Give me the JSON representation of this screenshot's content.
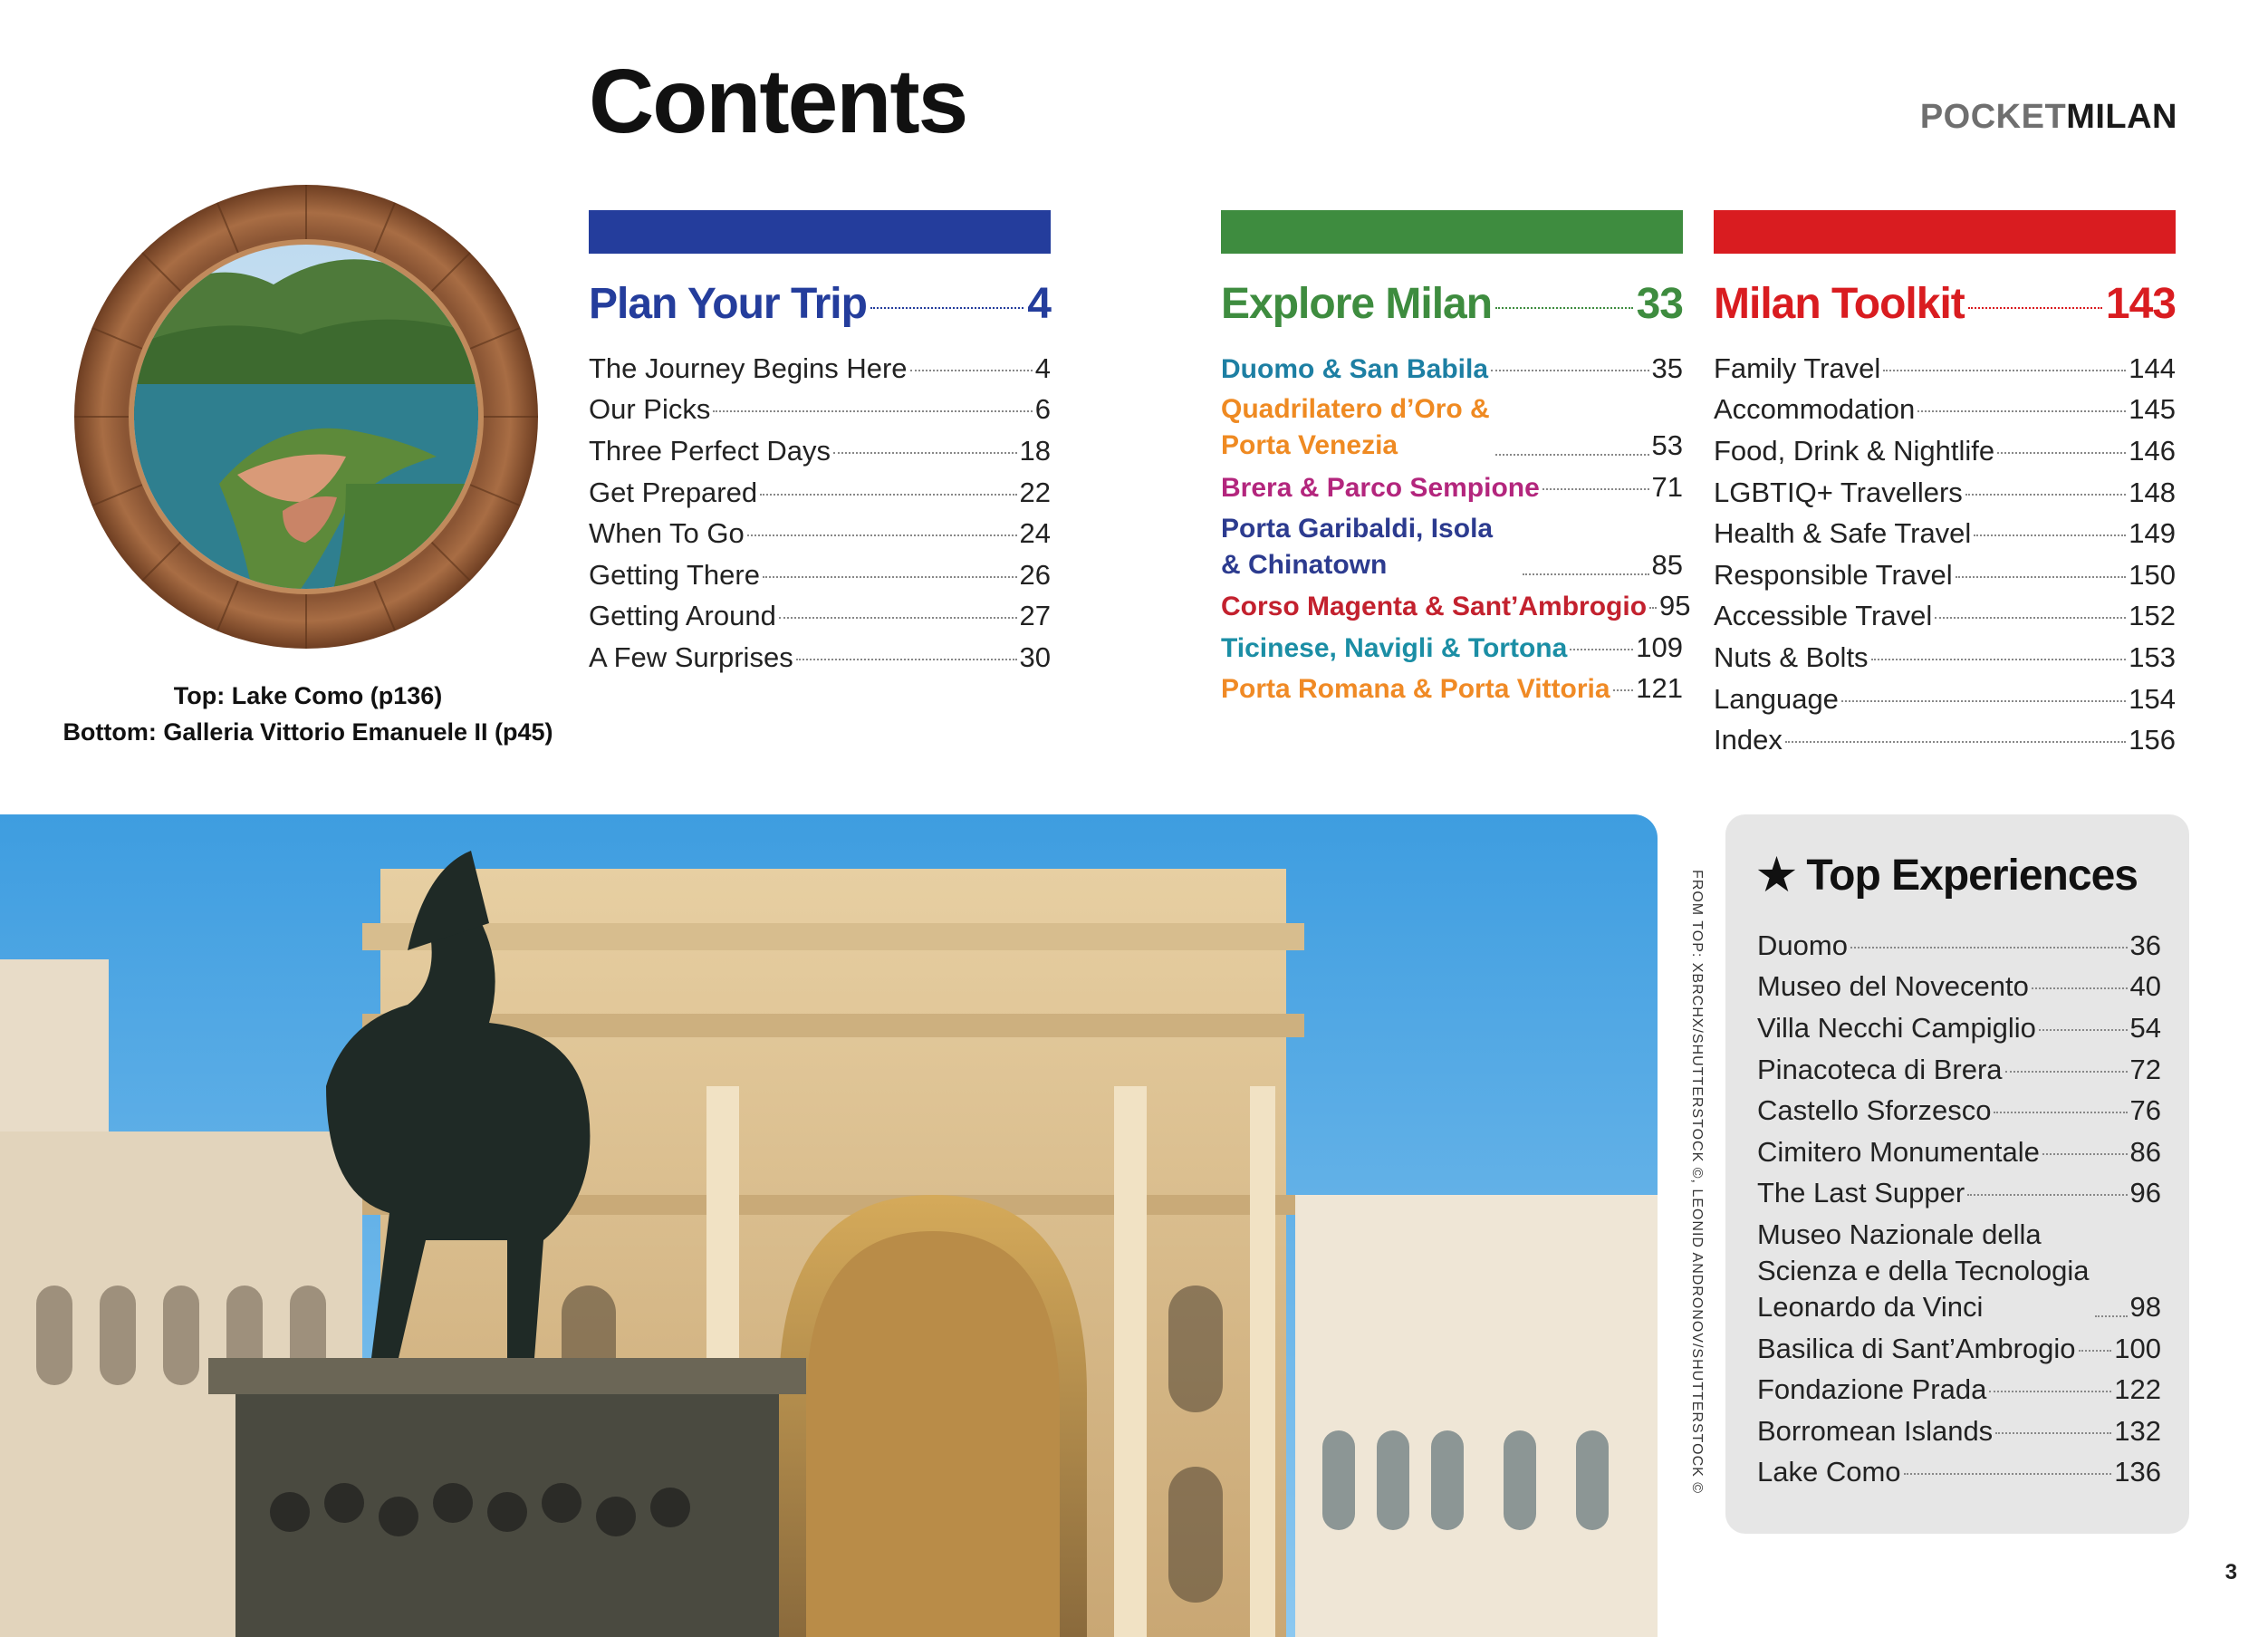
{
  "header": {
    "title": "Contents",
    "brand_prefix": "POCKET",
    "brand_name": "MILAN"
  },
  "colors": {
    "plan": "#243d9c",
    "explore": "#3e8c3f",
    "toolkit": "#d91c20"
  },
  "plan": {
    "heading": "Plan Your Trip",
    "page": "4",
    "items": [
      {
        "label": "The Journey Begins Here",
        "page": "4"
      },
      {
        "label": "Our Picks",
        "page": "6"
      },
      {
        "label": "Three Perfect Days",
        "page": "18"
      },
      {
        "label": "Get Prepared",
        "page": "22"
      },
      {
        "label": "When To Go",
        "page": "24"
      },
      {
        "label": "Getting There",
        "page": "26"
      },
      {
        "label": "Getting Around",
        "page": "27"
      },
      {
        "label": "A Few Surprises",
        "page": "30"
      }
    ]
  },
  "explore": {
    "heading": "Explore Milan",
    "page": "33",
    "items": [
      {
        "label": "Duomo & San Babila",
        "page": "35",
        "color": "#1d7fa3"
      },
      {
        "label": "Quadrilatero d’Oro & Porta Venezia",
        "page": "53",
        "color": "#ef8a22"
      },
      {
        "label": "Brera & Parco Sempione",
        "page": "71",
        "color": "#b3267d"
      },
      {
        "label": "Porta Garibaldi, Isola & Chinatown",
        "page": "85",
        "color": "#2c3b8f"
      },
      {
        "label": "Corso Magenta & Sant’Ambrogio",
        "page": "95",
        "color": "#c3212e"
      },
      {
        "label": "Ticinese, Navigli & Tortona",
        "page": "109",
        "color": "#1b8ea5"
      },
      {
        "label": "Porta Romana & Porta Vittoria",
        "page": "121",
        "color": "#f08a25"
      }
    ]
  },
  "toolkit": {
    "heading": "Milan Toolkit",
    "page": "143",
    "items": [
      {
        "label": "Family Travel",
        "page": "144"
      },
      {
        "label": "Accommodation",
        "page": "145"
      },
      {
        "label": "Food, Drink & Nightlife",
        "page": "146"
      },
      {
        "label": "LGBTIQ+ Travellers",
        "page": "148"
      },
      {
        "label": "Health & Safe Travel",
        "page": "149"
      },
      {
        "label": "Responsible Travel",
        "page": "150"
      },
      {
        "label": "Accessible Travel",
        "page": "152"
      },
      {
        "label": "Nuts & Bolts",
        "page": "153"
      },
      {
        "label": "Language",
        "page": "154"
      },
      {
        "label": "Index",
        "page": "156"
      }
    ]
  },
  "top_experiences": {
    "star": "★",
    "heading": "Top Experiences",
    "items": [
      {
        "label": "Duomo",
        "page": "36"
      },
      {
        "label": "Museo del Novecento",
        "page": "40"
      },
      {
        "label": "Villa Necchi Campiglio",
        "page": "54"
      },
      {
        "label": "Pinacoteca di Brera",
        "page": "72"
      },
      {
        "label": "Castello Sforzesco",
        "page": "76"
      },
      {
        "label": "Cimitero Monumentale",
        "page": "86"
      },
      {
        "label": "The Last Supper",
        "page": "96"
      },
      {
        "label": "Museo Nazionale della Scienza e della Tecnologia Leonardo da Vinci",
        "page": "98"
      },
      {
        "label": "Basilica di Sant’Ambrogio",
        "page": "100"
      },
      {
        "label": "Fondazione Prada",
        "page": "122"
      },
      {
        "label": "Borromean Islands",
        "page": "132"
      },
      {
        "label": "Lake Como",
        "page": "136"
      }
    ]
  },
  "caption": {
    "line1": "Top: Lake Como (p136)",
    "line2": "Bottom: Galleria Vittorio Emanuele II (p45)"
  },
  "credit": "FROM TOP: XBRCHX/SHUTTERSTOCK ©, LEONID ANDRONOV/SHUTTERSTOCK ©",
  "page_number": "3"
}
